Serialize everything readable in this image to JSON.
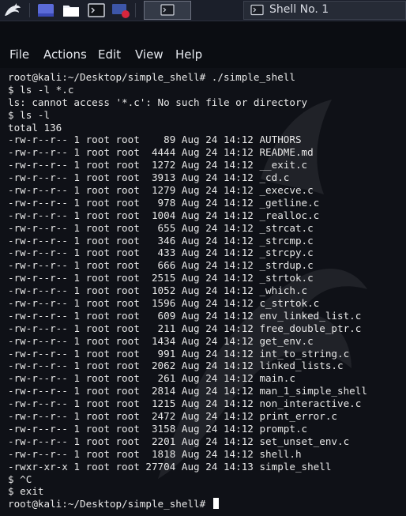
{
  "taskbar": {
    "items": [
      {
        "icon": "kali-dragon-icon"
      },
      {
        "icon": "app-launcher-icon"
      },
      {
        "icon": "folder-icon"
      },
      {
        "icon": "terminal-icon"
      },
      {
        "icon": "screen-recorder-icon"
      }
    ],
    "active_task_icon": "terminal-icon",
    "window_task_label": "Shell No. 1"
  },
  "menu": {
    "file": "File",
    "actions": "Actions",
    "edit": "Edit",
    "view": "View",
    "help": "Help"
  },
  "terminal": {
    "lines": [
      "root@kali:~/Desktop/simple_shell# ./simple_shell",
      "$ ls -l *.c",
      "ls: cannot access '*.c': No such file or directory",
      "$ ls -l",
      "total 136",
      "-rw-r--r-- 1 root root    89 Aug 24 14:12 AUTHORS",
      "-rw-r--r-- 1 root root  4444 Aug 24 14:12 README.md",
      "-rw-r--r-- 1 root root  1272 Aug 24 14:12 __exit.c",
      "-rw-r--r-- 1 root root  3913 Aug 24 14:12 _cd.c",
      "-rw-r--r-- 1 root root  1279 Aug 24 14:12 _execve.c",
      "-rw-r--r-- 1 root root   978 Aug 24 14:12 _getline.c",
      "-rw-r--r-- 1 root root  1004 Aug 24 14:12 _realloc.c",
      "-rw-r--r-- 1 root root   655 Aug 24 14:12 _strcat.c",
      "-rw-r--r-- 1 root root   346 Aug 24 14:12 _strcmp.c",
      "-rw-r--r-- 1 root root   433 Aug 24 14:12 _strcpy.c",
      "-rw-r--r-- 1 root root   666 Aug 24 14:12 _strdup.c",
      "-rw-r--r-- 1 root root  2515 Aug 24 14:12 _strtok.c",
      "-rw-r--r-- 1 root root  1052 Aug 24 14:12 _which.c",
      "-rw-r--r-- 1 root root  1596 Aug 24 14:12 c_strtok.c",
      "-rw-r--r-- 1 root root   609 Aug 24 14:12 env_linked_list.c",
      "-rw-r--r-- 1 root root   211 Aug 24 14:12 free_double_ptr.c",
      "-rw-r--r-- 1 root root  1434 Aug 24 14:12 get_env.c",
      "-rw-r--r-- 1 root root   991 Aug 24 14:12 int_to_string.c",
      "-rw-r--r-- 1 root root  2062 Aug 24 14:12 linked_lists.c",
      "-rw-r--r-- 1 root root   261 Aug 24 14:12 main.c",
      "-rw-r--r-- 1 root root  2814 Aug 24 14:12 man_1_simple_shell",
      "-rw-r--r-- 1 root root  1215 Aug 24 14:12 non_interactive.c",
      "-rw-r--r-- 1 root root  2472 Aug 24 14:12 print_error.c",
      "-rw-r--r-- 1 root root  3158 Aug 24 14:12 prompt.c",
      "-rw-r--r-- 1 root root  2201 Aug 24 14:12 set_unset_env.c",
      "-rw-r--r-- 1 root root  1818 Aug 24 14:12 shell.h",
      "-rwxr-xr-x 1 root root 27704 Aug 24 14:13 simple_shell",
      "$ ^C",
      "$ exit"
    ],
    "prompt": "root@kali:~/Desktop/simple_shell# "
  },
  "colors": {
    "terminal_bg": "#0f1117",
    "terminal_fg": "#e8e8e8",
    "taskbar_bg": "#1b1f2a"
  }
}
